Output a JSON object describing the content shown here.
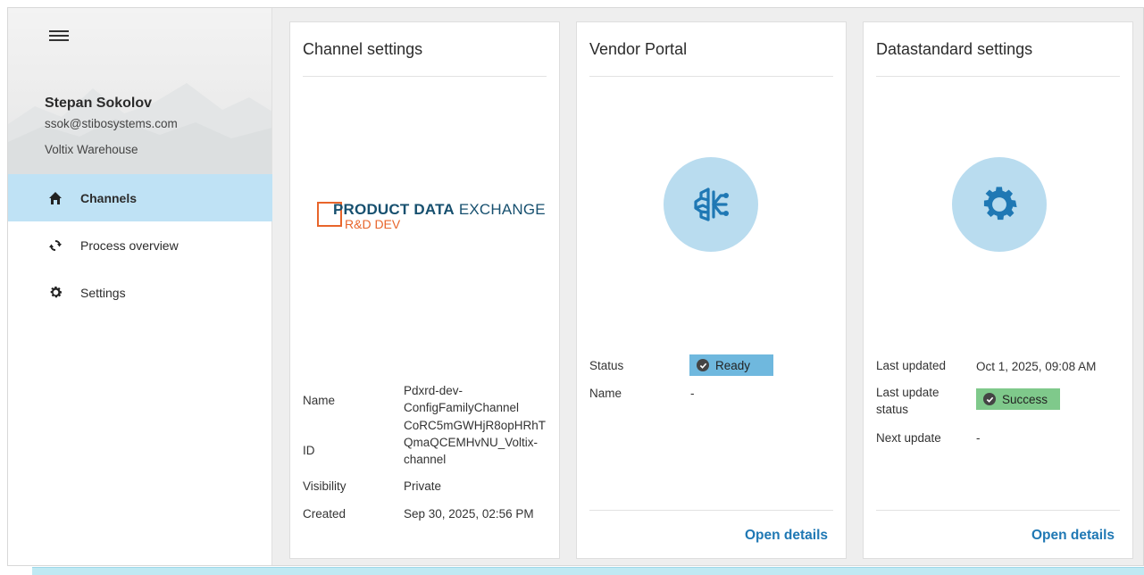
{
  "sidebar": {
    "user_name": "Stepan Sokolov",
    "user_email": "ssok@stibosystems.com",
    "organization": "Voltix Warehouse",
    "nav": [
      {
        "label": "Channels",
        "icon": "home-icon",
        "active": true
      },
      {
        "label": "Process overview",
        "icon": "sync-icon",
        "active": false
      },
      {
        "label": "Settings",
        "icon": "gear-icon",
        "active": false
      }
    ]
  },
  "channel_card": {
    "title": "Channel settings",
    "logo": {
      "main_bold": "PRODUCT DATA",
      "main_light": "EXCHANGE",
      "sub": "R&D DEV"
    },
    "fields": {
      "name_label": "Name",
      "name_value_line1": "Pdxrd-dev-",
      "name_value_line2": "ConfigFamilyChannel",
      "id_label": "ID",
      "id_value_line1": "CoRC5mGWHjR8opHRhT",
      "id_value_line2": "QmaQCEMHvNU_Voltix-",
      "id_value_line3": "channel",
      "visibility_label": "Visibility",
      "visibility_value": "Private",
      "created_label": "Created",
      "created_value": "Sep 30, 2025, 02:56 PM"
    }
  },
  "vendor_card": {
    "title": "Vendor Portal",
    "icon": "ai-brain-icon",
    "status_label": "Status",
    "status_value": "Ready",
    "name_label": "Name",
    "name_value": "-",
    "open_details": "Open details",
    "colors": {
      "circle": "#b9dcef",
      "badge": "#6fb8de"
    }
  },
  "datastandard_card": {
    "title": "Datastandard settings",
    "icon": "gear-icon",
    "last_updated_label": "Last updated",
    "last_updated_value": "Oct 1, 2025, 09:08 AM",
    "last_update_status_label_line1": "Last update",
    "last_update_status_label_line2": "status",
    "last_update_status_value": "Success",
    "next_update_label": "Next update",
    "next_update_value": "-",
    "open_details": "Open details",
    "colors": {
      "circle": "#b9dcef",
      "badge": "#7fc98b",
      "icon": "#1f78b4"
    }
  },
  "theme": {
    "accent": "#1f78b4",
    "active_nav": "#bfe2f5",
    "logo_orange": "#e8652b",
    "logo_blue": "#17506f"
  }
}
